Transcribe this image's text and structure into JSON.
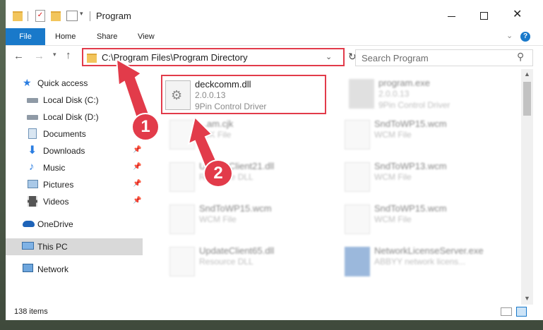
{
  "window": {
    "title": "Program"
  },
  "ribbon": {
    "tabs": [
      "File",
      "Home",
      "Share",
      "View"
    ]
  },
  "address": {
    "path": "C:\\Program Files\\Program Directory",
    "search_placeholder": "Search Program"
  },
  "nav": {
    "items": [
      {
        "label": "Quick access",
        "icon": "star-icon"
      },
      {
        "label": "Local Disk (C:)",
        "icon": "drive-icon"
      },
      {
        "label": "Local Disk (D:)",
        "icon": "drive-icon"
      },
      {
        "label": "Documents",
        "icon": "documents-icon"
      },
      {
        "label": "Downloads",
        "icon": "downloads-icon"
      },
      {
        "label": "Music",
        "icon": "music-icon"
      },
      {
        "label": "Pictures",
        "icon": "pictures-icon"
      },
      {
        "label": "Videos",
        "icon": "videos-icon"
      },
      {
        "label": "OneDrive",
        "icon": "cloud-icon"
      },
      {
        "label": "This PC",
        "icon": "monitor-icon"
      },
      {
        "label": "Network",
        "icon": "network-icon"
      }
    ]
  },
  "files": {
    "highlighted": {
      "name": "deckcomm.dll",
      "version": "2.0.0.13",
      "description": "9Pin Control Driver"
    },
    "others": [
      {
        "name": "program.exe",
        "line2": "2.0.0.13",
        "line3": "9Pin Control Driver"
      },
      {
        "name": "...am.cjk",
        "line2": "CJK File",
        "line3": ""
      },
      {
        "name": "SndToWP15.wcm",
        "line2": "WCM File",
        "line3": ""
      },
      {
        "name": "UpdateClient21.dll",
        "line2": "Resource DLL",
        "line3": ""
      },
      {
        "name": "SndToWP13.wcm",
        "line2": "WCM File",
        "line3": ""
      },
      {
        "name": "SndToWP15.wcm",
        "line2": "WCM File",
        "line3": ""
      },
      {
        "name": "SndToWP15.wcm",
        "line2": "WCM File",
        "line3": ""
      },
      {
        "name": "UpdateClient65.dll",
        "line2": "Resource DLL",
        "line3": ""
      },
      {
        "name": "NetworkLicenseServer.exe",
        "line2": "ABBYY network licens...",
        "line3": ""
      }
    ]
  },
  "status": {
    "item_count": "138 items"
  },
  "callouts": {
    "one": "1",
    "two": "2"
  },
  "colors": {
    "accent": "#1979ca",
    "highlight": "#e23b4a"
  }
}
